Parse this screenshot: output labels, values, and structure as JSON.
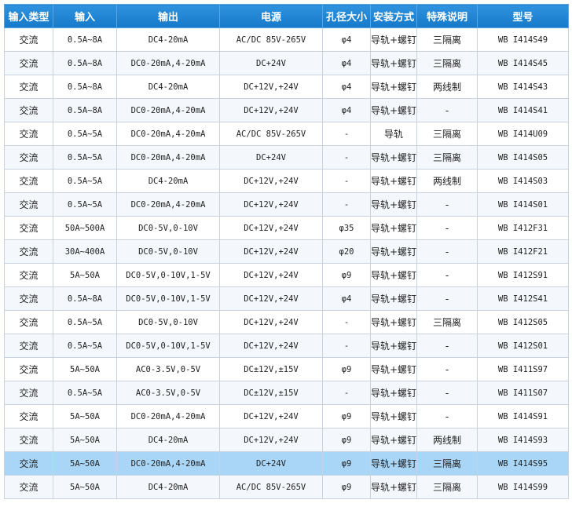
{
  "headers": [
    "输入类型",
    "输入",
    "输出",
    "电源",
    "孔径大小",
    "安装方式",
    "特殊说明",
    "型号"
  ],
  "selected_row": 19,
  "rows": [
    [
      "交流",
      "0.5A~8A",
      "DC4-20mA",
      "AC/DC 85V-265V",
      "φ4",
      "导轨+螺钉",
      "三隔离",
      "WB I414S49"
    ],
    [
      "交流",
      "0.5A~8A",
      "DC0-20mA,4-20mA",
      "DC+24V",
      "φ4",
      "导轨+螺钉",
      "三隔离",
      "WB I414S45"
    ],
    [
      "交流",
      "0.5A~8A",
      "DC4-20mA",
      "DC+12V,+24V",
      "φ4",
      "导轨+螺钉",
      "两线制",
      "WB I414S43"
    ],
    [
      "交流",
      "0.5A~8A",
      "DC0-20mA,4-20mA",
      "DC+12V,+24V",
      "φ4",
      "导轨+螺钉",
      "-",
      "WB I414S41"
    ],
    [
      "交流",
      "0.5A~5A",
      "DC0-20mA,4-20mA",
      "AC/DC 85V-265V",
      "-",
      "导轨",
      "三隔离",
      "WB I414U09"
    ],
    [
      "交流",
      "0.5A~5A",
      "DC0-20mA,4-20mA",
      "DC+24V",
      "-",
      "导轨+螺钉",
      "三隔离",
      "WB I414S05"
    ],
    [
      "交流",
      "0.5A~5A",
      "DC4-20mA",
      "DC+12V,+24V",
      "-",
      "导轨+螺钉",
      "两线制",
      "WB I414S03"
    ],
    [
      "交流",
      "0.5A~5A",
      "DC0-20mA,4-20mA",
      "DC+12V,+24V",
      "-",
      "导轨+螺钉",
      "-",
      "WB I414S01"
    ],
    [
      "交流",
      "50A~500A",
      "DC0-5V,0-10V",
      "DC+12V,+24V",
      "φ35",
      "导轨+螺钉",
      "-",
      "WB I412F31"
    ],
    [
      "交流",
      "30A~400A",
      "DC0-5V,0-10V",
      "DC+12V,+24V",
      "φ20",
      "导轨+螺钉",
      "-",
      "WB I412F21"
    ],
    [
      "交流",
      "5A~50A",
      "DC0-5V,0-10V,1-5V",
      "DC+12V,+24V",
      "φ9",
      "导轨+螺钉",
      "-",
      "WB I412S91"
    ],
    [
      "交流",
      "0.5A~8A",
      "DC0-5V,0-10V,1-5V",
      "DC+12V,+24V",
      "φ4",
      "导轨+螺钉",
      "-",
      "WB I412S41"
    ],
    [
      "交流",
      "0.5A~5A",
      "DC0-5V,0-10V",
      "DC+12V,+24V",
      "-",
      "导轨+螺钉",
      "三隔离",
      "WB I412S05"
    ],
    [
      "交流",
      "0.5A~5A",
      "DC0-5V,0-10V,1-5V",
      "DC+12V,+24V",
      "-",
      "导轨+螺钉",
      "-",
      "WB I412S01"
    ],
    [
      "交流",
      "5A~50A",
      "AC0-3.5V,0-5V",
      "DC±12V,±15V",
      "φ9",
      "导轨+螺钉",
      "-",
      "WB I411S97"
    ],
    [
      "交流",
      "0.5A~5A",
      "AC0-3.5V,0-5V",
      "DC±12V,±15V",
      "-",
      "导轨+螺钉",
      "-",
      "WB I411S07"
    ],
    [
      "交流",
      "5A~50A",
      "DC0-20mA,4-20mA",
      "DC+12V,+24V",
      "φ9",
      "导轨+螺钉",
      "-",
      "WB I414S91"
    ],
    [
      "交流",
      "5A~50A",
      "DC4-20mA",
      "DC+12V,+24V",
      "φ9",
      "导轨+螺钉",
      "两线制",
      "WB I414S93"
    ],
    [
      "交流",
      "5A~50A",
      "DC0-20mA,4-20mA",
      "DC+24V",
      "φ9",
      "导轨+螺钉",
      "三隔离",
      "WB I414S95"
    ],
    [
      "交流",
      "5A~50A",
      "DC4-20mA",
      "AC/DC 85V-265V",
      "φ9",
      "导轨+螺钉",
      "三隔离",
      "WB I414S99"
    ]
  ]
}
